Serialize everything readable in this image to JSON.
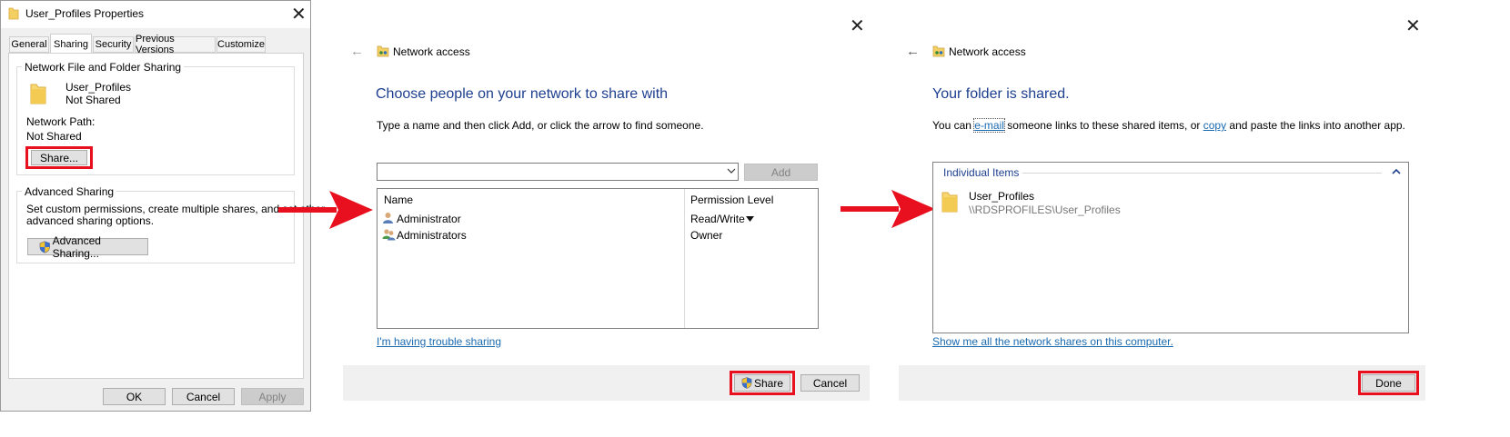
{
  "props": {
    "title": "User_Profiles Properties",
    "tabs": [
      "General",
      "Sharing",
      "Security",
      "Previous Versions",
      "Customize"
    ],
    "group1_label": "Network File and Folder Sharing",
    "folder_name": "User_Profiles",
    "folder_status": "Not Shared",
    "path_label": "Network Path:",
    "path_value": "Not Shared",
    "share_button": "Share...",
    "group2_label": "Advanced Sharing",
    "adv_desc_line1": "Set custom permissions, create multiple shares, and set other",
    "adv_desc_line2": "advanced sharing options.",
    "adv_button": "Advanced Sharing...",
    "ok": "OK",
    "cancel": "Cancel",
    "apply": "Apply"
  },
  "wizard1": {
    "title": "Network access",
    "heading": "Choose people on your network to share with",
    "instruction": "Type a name and then click Add, or click the arrow to find someone.",
    "add_button": "Add",
    "col_name": "Name",
    "col_perm": "Permission Level",
    "rows": [
      {
        "name": "Administrator",
        "perm": "Read/Write"
      },
      {
        "name": "Administrators",
        "perm": "Owner"
      }
    ],
    "trouble_link": "I'm having trouble sharing",
    "share_button": "Share",
    "cancel_button": "Cancel"
  },
  "wizard2": {
    "title": "Network access",
    "heading": "Your folder is shared.",
    "desc_part1": "You can ",
    "desc_email": "e-mail",
    "desc_part2": " someone links to these shared items, or ",
    "desc_copy": "copy",
    "desc_part3": " and paste the links into another app.",
    "section_label": "Individual Items",
    "item_name": "User_Profiles",
    "item_path": "\\\\RDSPROFILES\\User_Profiles",
    "shares_link": "Show me all the network shares on this computer.",
    "done_button": "Done"
  },
  "colors": {
    "highlight": "#e8101e",
    "heading_blue": "#1e3f8f",
    "link_blue": "#1a6ab0",
    "footer_gray": "#f0f0f0"
  }
}
